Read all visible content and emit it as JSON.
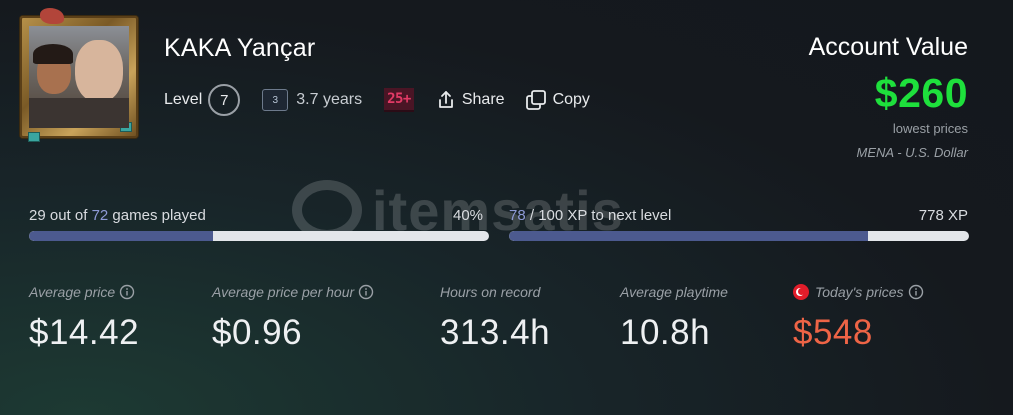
{
  "profile": {
    "name": "KAKA Yançar",
    "level_label": "Level",
    "level": "7",
    "years_badge": "3",
    "years_text": "3.7 years",
    "age_rating": "25+",
    "share_label": "Share",
    "copy_label": "Copy"
  },
  "account": {
    "title": "Account Value",
    "value": "$260",
    "note": "lowest prices",
    "region": "MENA - U.S. Dollar",
    "value_color": "#1ee03c"
  },
  "watermark": {
    "text": "itemsatis"
  },
  "games_progress": {
    "played": "29",
    "out_of_text": "out of",
    "total": "72",
    "suffix": "games played",
    "percent_label": "40%",
    "fraction": 0.4
  },
  "xp_progress": {
    "current": "78",
    "rest": "/ 100 XP to next level",
    "total_xp": "778 XP",
    "fraction": 0.78
  },
  "stats": [
    {
      "label": "Average price",
      "value": "$14.42",
      "info": true
    },
    {
      "label": "Average price per hour",
      "value": "$0.96",
      "info": true
    },
    {
      "label": "Hours on record",
      "value": "313.4h",
      "info": false
    },
    {
      "label": "Average playtime",
      "value": "10.8h",
      "info": false
    },
    {
      "label": "Today's prices",
      "value": "$548",
      "info": true,
      "flag": "turkey-flag-icon",
      "value_color": "#ee6446"
    }
  ],
  "icons": [
    "share-icon",
    "copy-icon",
    "info-icon",
    "turkey-flag-icon"
  ]
}
